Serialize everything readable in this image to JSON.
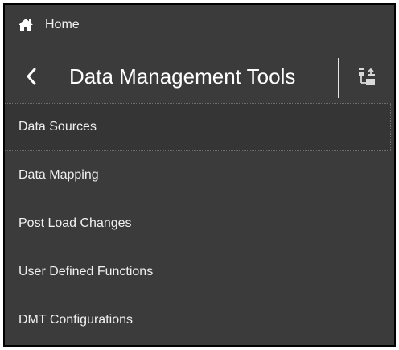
{
  "nav": {
    "home_label": "Home",
    "home_icon": "home-icon"
  },
  "header": {
    "back_icon": "chevron-left-icon",
    "title": "Data Management Tools",
    "tree_icon": "tree-view-icon"
  },
  "menu": {
    "items": [
      {
        "label": "Data Sources",
        "selected": true
      },
      {
        "label": "Data Mapping",
        "selected": false
      },
      {
        "label": "Post Load Changes",
        "selected": false
      },
      {
        "label": "User Defined Functions",
        "selected": false
      },
      {
        "label": "DMT Configurations",
        "selected": false
      }
    ]
  },
  "colors": {
    "panel_background": "#3b3b3b",
    "text": "#ffffff",
    "divider": "#e6e6e6"
  }
}
